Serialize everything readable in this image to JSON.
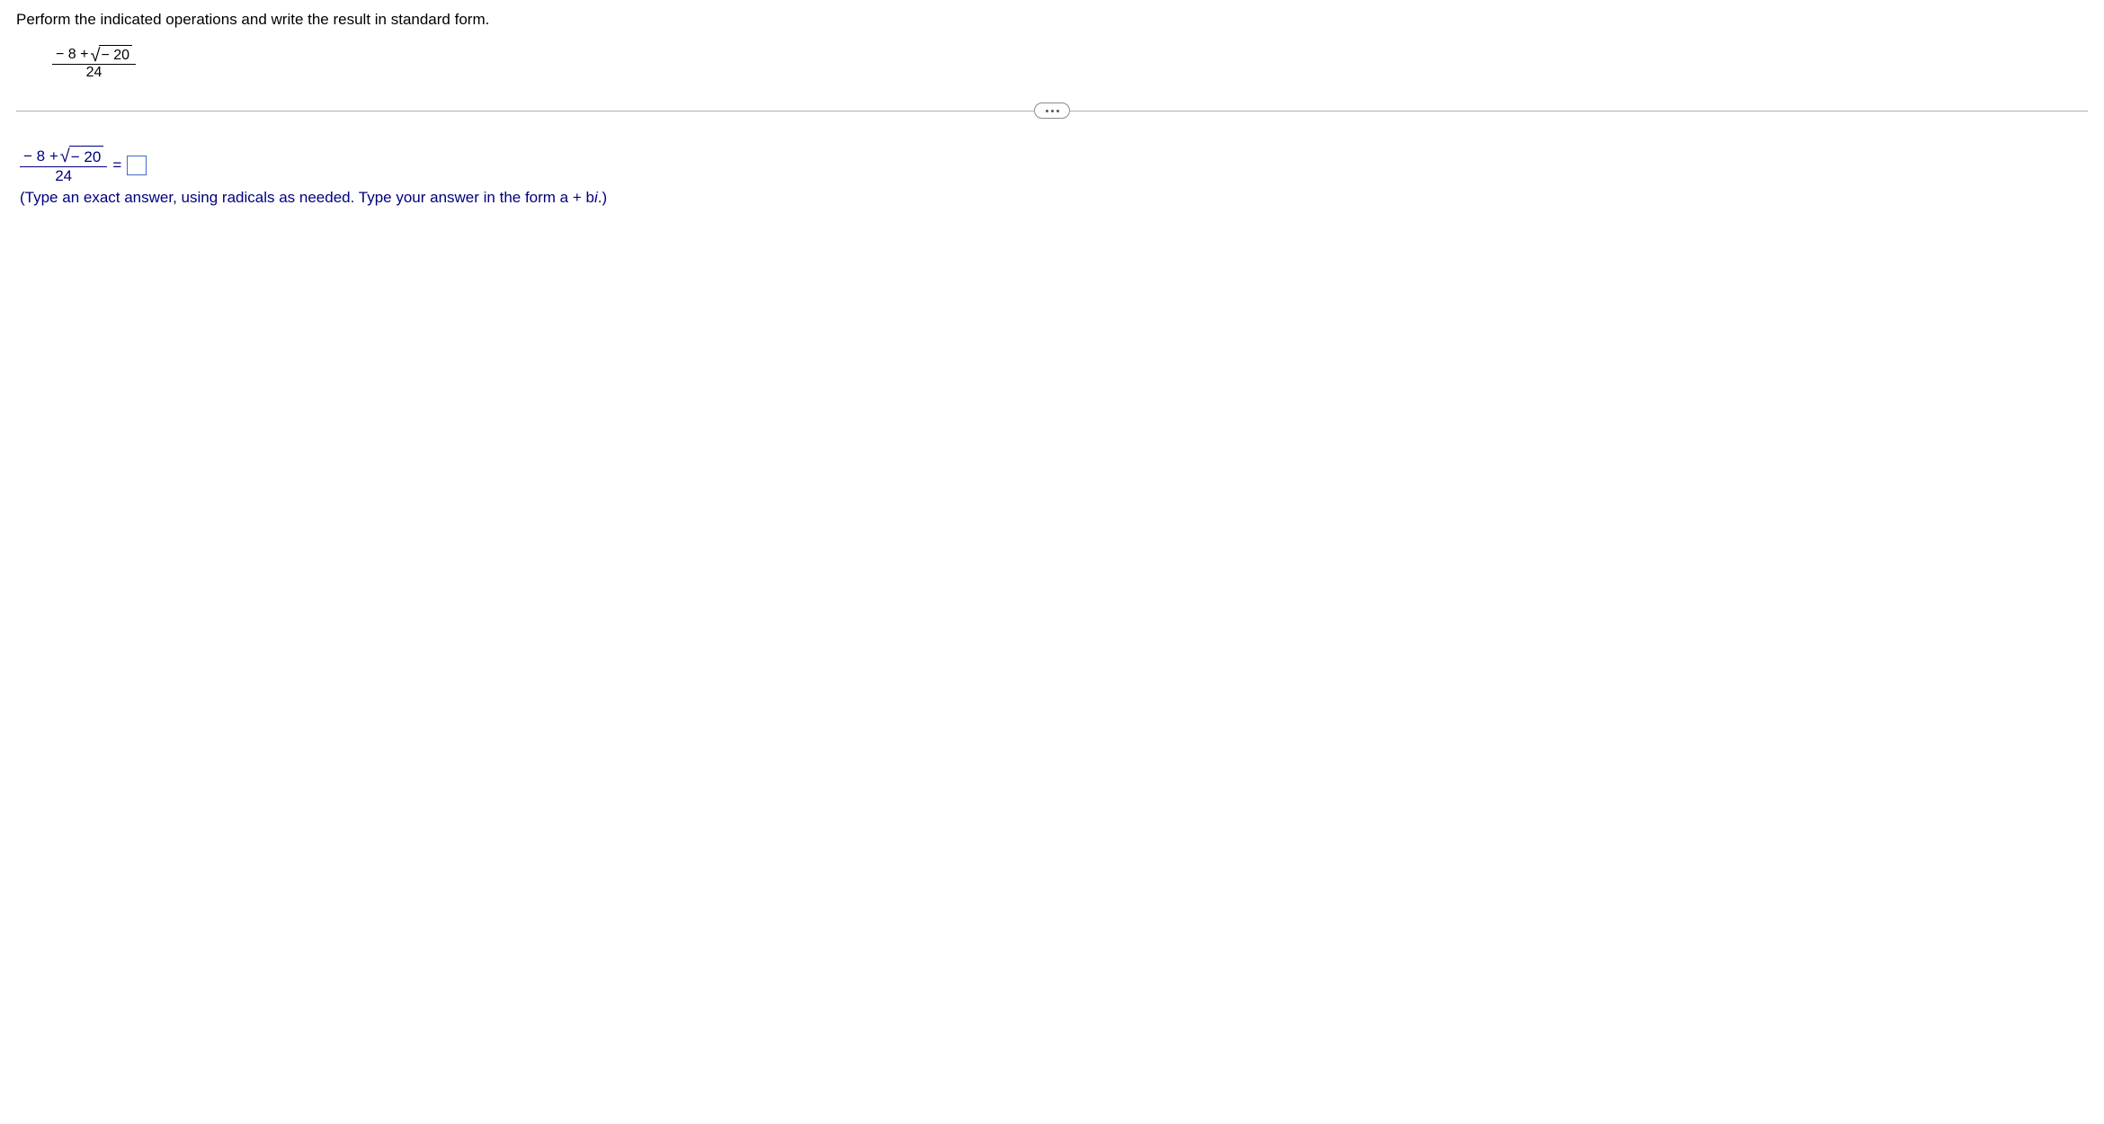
{
  "instruction": "Perform the indicated operations and write the result in standard form.",
  "expression": {
    "numerator_left": "− 8 +",
    "radicand": "− 20",
    "denominator": "24"
  },
  "answer": {
    "equals": "=",
    "input_value": ""
  },
  "hint": {
    "pre": "(Type an exact answer, using radicals as needed. Type your answer in the form a + b",
    "i": "i",
    "post": ".)"
  }
}
